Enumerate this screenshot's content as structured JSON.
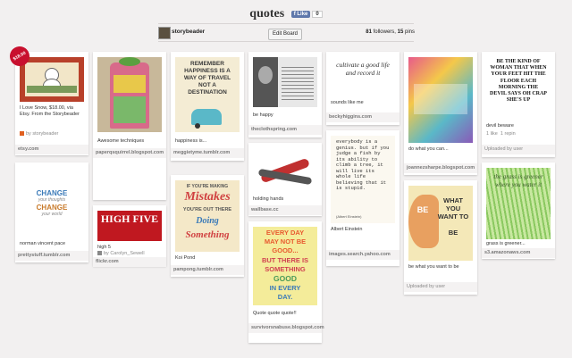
{
  "board": {
    "title": "quotes",
    "like_label": "Like",
    "like_count": "0",
    "owner": "storybeader",
    "edit_label": "Edit Board",
    "followers_count": "81",
    "followers_label": "followers,",
    "pins_count": "15",
    "pins_label": "pins"
  },
  "pins": {
    "p1": {
      "price": "$18.00",
      "desc": "I Love Snow, $18.00, via Etsy. From the Storybeader",
      "by": "by storybeader",
      "src": "etsy.com"
    },
    "p2": {
      "text_l1": "CHANGE",
      "text_l2": "your thoughts",
      "text_l3": "CHANGE",
      "text_l4": "your world",
      "desc": "norman vincent pace",
      "src": "prettystuff.tumblr.com"
    },
    "p3": {
      "desc": "Awesome techniques",
      "src": "paperqsquirrel.blogspot.com"
    },
    "p4": {
      "text": "HIGH FIVE",
      "desc": "high 5",
      "by": "by Carolyn_Sewell",
      "src": "flickr.com"
    },
    "p5": {
      "text": "REMEMBER HAPPINESS IS A WAY OF TRAVEL NOT A DESTINATION",
      "desc": "happiness is...",
      "src": "meggietyme.tumblr.com"
    },
    "p6": {
      "text_l1": "IF YOU'RE MAKING",
      "text_l2": "Mistakes",
      "text_l3": "YOU'RE OUT THERE",
      "text_l4": "Doing",
      "text_l5": "Something",
      "desc": "Koi Pond",
      "src": "pampong.tumblr.com"
    },
    "p7": {
      "desc": "be happy",
      "src": "theclothspring.com"
    },
    "p8": {
      "desc": "holding hands",
      "src": "wallbase.cc"
    },
    "p9": {
      "text_l1": "EVERY DAY",
      "text_l2": "MAY NOT BE",
      "text_l3": "GOOD...",
      "text_l4": "BUT THERE IS",
      "text_l5": "SOMETHING",
      "text_l6": "GOOD",
      "text_l7": "IN EVERY",
      "text_l8": "DAY.",
      "desc": "Quote quote quote!!",
      "src": "survivorsnabuse.blogspot.com"
    },
    "p10": {
      "text": "cultivate a good life and record it",
      "desc": "sounds like me",
      "src": "beckyhiggins.com"
    },
    "p11": {
      "text": "everybody is a genius. but if you judge a fish by its ability to climb a tree, it will live its whole life believing that it is stupid.",
      "caption": "(Albert Einstein)",
      "desc": "Albert Einstein",
      "src": "images.search.yahoo.com"
    },
    "p12": {
      "desc": "do what you can...",
      "src": "joannezsharpe.blogspot.com"
    },
    "p13": {
      "text_l1": "BE",
      "text_l2": "WHAT YOU",
      "text_l3": "WANT TO",
      "text_l4": "BE",
      "desc": "be what you want to be",
      "src": "Uploaded by user"
    },
    "p14": {
      "text": "BE THE KIND OF WOMAN THAT WHEN YOUR FEET HIT THE FLOOR EACH MORNING THE DEVIL SAYS OH CRAP SHE'S UP",
      "desc": "devil beware",
      "meta": "1 like  1 repin",
      "src": "Uploaded by user"
    },
    "p15": {
      "text": "the grass is greener where you water it",
      "desc": "grass is greener...",
      "src": "s3.amazonaws.com"
    }
  },
  "colors": {
    "background": "#f2f0f0",
    "facebook_blue": "#5f78ab",
    "price_red": "#c8102e"
  }
}
